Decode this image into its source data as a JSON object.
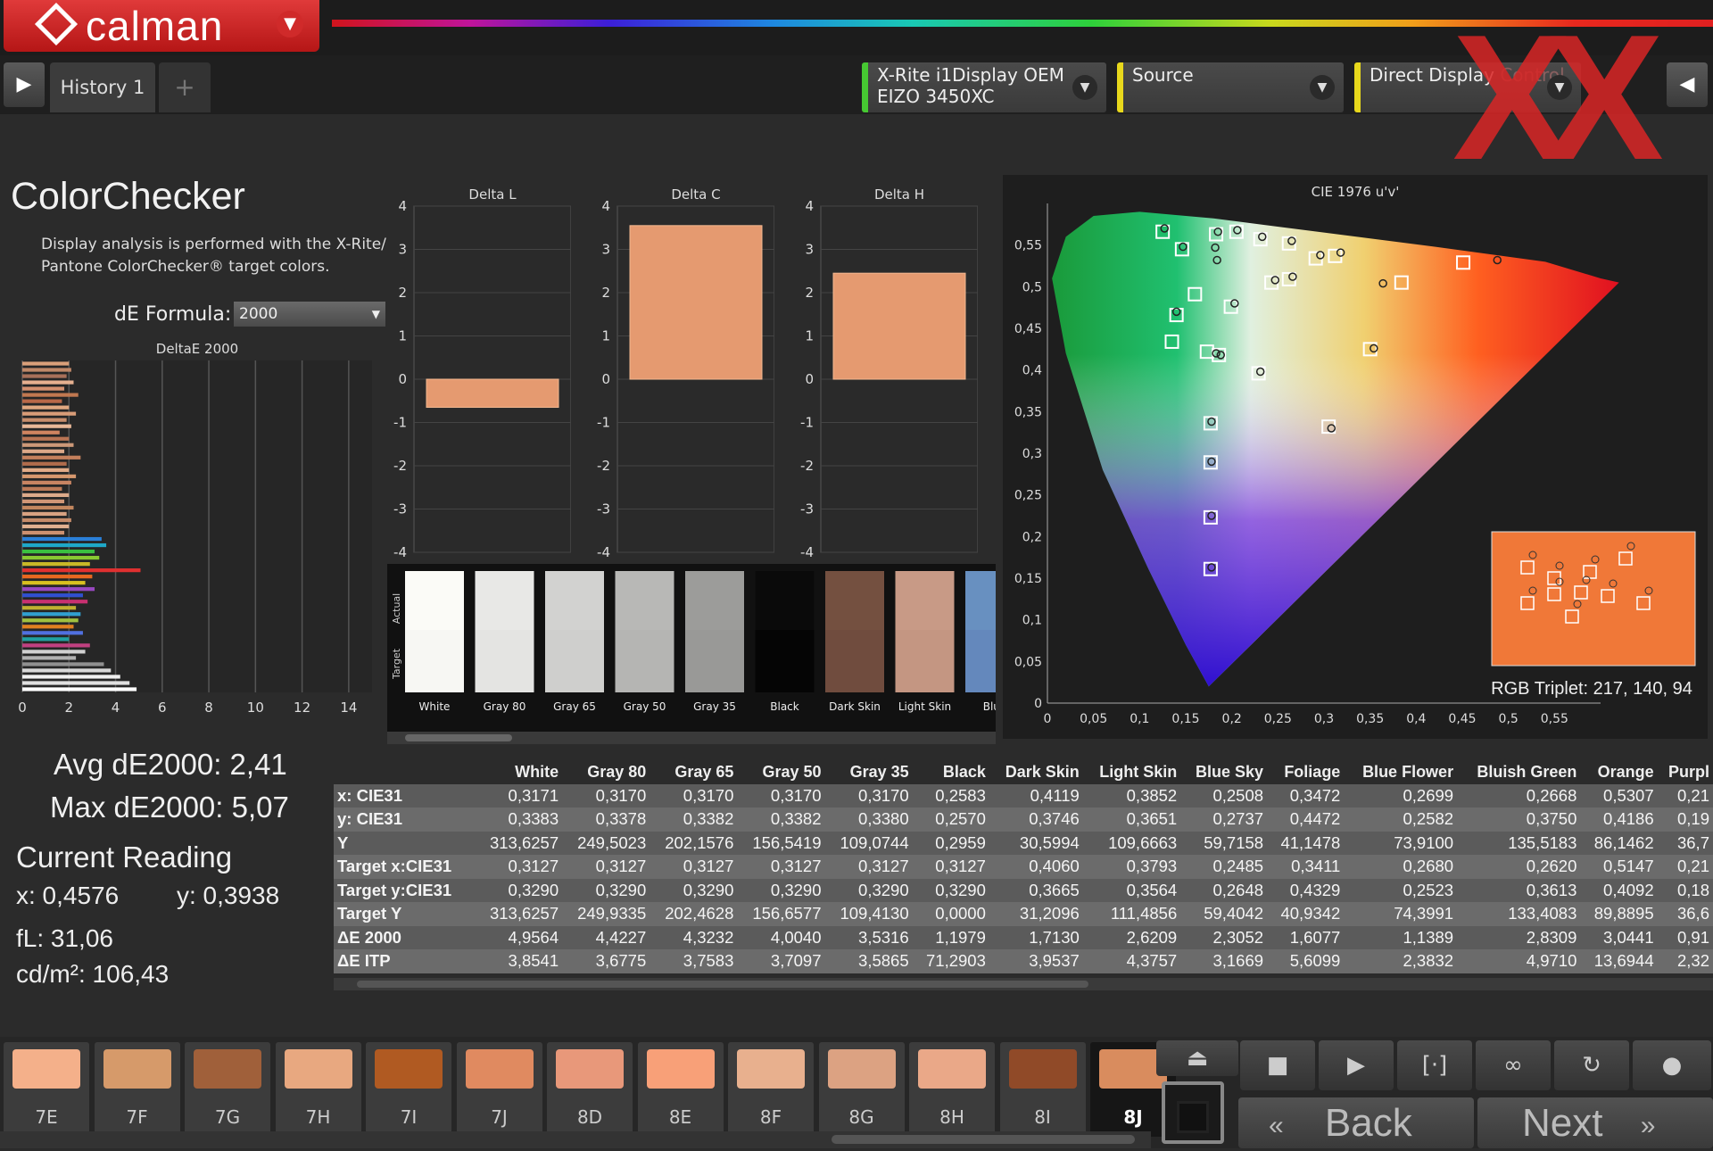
{
  "app": {
    "brand": "calman",
    "menu_icon": "chevron-down-icon"
  },
  "tabs": {
    "history_label": "History 1",
    "add_label": "+"
  },
  "devices": {
    "meter_line1": "X-Rite i1Display OEM",
    "meter_line2": "EIZO 3450XC",
    "source": "Source",
    "display": "Direct Display",
    "display_ghost": "Control"
  },
  "watermark": "XX",
  "page": {
    "title": "ColorChecker",
    "description": "Display analysis is performed with the X-Rite/ Pantone ColorChecker® target colors.",
    "formula_label": "dE Formula:",
    "formula_value": "2000"
  },
  "stats": {
    "avg": "Avg dE2000: 2,41",
    "max": "Max dE2000: 5,07",
    "current_title": "Current Reading",
    "x": "x: 0,4576",
    "y": "y: 0,3938",
    "fl": "fL: 31,06",
    "cdm2": "cd/m²: 106,43"
  },
  "chart_data": [
    {
      "type": "bar",
      "orientation": "horizontal",
      "title": "DeltaE 2000",
      "xlim": [
        0,
        15
      ],
      "xticks": [
        "0",
        "2",
        "4",
        "6",
        "8",
        "10",
        "12",
        "14"
      ],
      "values": [
        2.0,
        2.1,
        1.9,
        2.2,
        1.8,
        2.4,
        1.7,
        2.0,
        2.3,
        1.9,
        2.1,
        1.6,
        2.0,
        2.2,
        1.8,
        2.5,
        1.9,
        2.0,
        2.3,
        2.1,
        1.7,
        2.0,
        1.8,
        2.2,
        1.9,
        2.1,
        2.0,
        1.8,
        3.4,
        3.6,
        3.1,
        3.3,
        2.9,
        5.07,
        3.0,
        2.7,
        3.1,
        2.6,
        2.8,
        2.3,
        2.5,
        2.4,
        2.2,
        2.6,
        2.0,
        2.9,
        2.7,
        2.3,
        3.5,
        3.8,
        4.2,
        4.6,
        4.9
      ],
      "colors": [
        "#d9a07a",
        "#c08868",
        "#a8705a",
        "#e6b090",
        "#d49070",
        "#c07850",
        "#b86848",
        "#e0a880",
        "#d89c78",
        "#c88e6c",
        "#e8b898",
        "#d08460",
        "#b87454",
        "#cc9878",
        "#dca888",
        "#c4805c",
        "#b06c4c",
        "#e2ac88",
        "#d6986e",
        "#c88462",
        "#bc7a58",
        "#dcaa8a",
        "#d09676",
        "#c2865e",
        "#d8a282",
        "#c68c6a",
        "#e0b090",
        "#cc9070",
        "#2a7fd8",
        "#1ea8c8",
        "#3ac040",
        "#88c832",
        "#c8b828",
        "#e03030",
        "#e86820",
        "#d8c020",
        "#9848c0",
        "#3050d0",
        "#c83070",
        "#c0b030",
        "#30a0d0",
        "#a0c040",
        "#e08020",
        "#5070e0",
        "#20a0a0",
        "#c04080",
        "#d0d0d0",
        "#b0b0b0",
        "#909090",
        "#d8d8d8",
        "#f0f0f0",
        "#e0e0e0",
        "#ffffff"
      ]
    },
    {
      "type": "bar",
      "title": "Delta L",
      "ylim": [
        -4,
        4
      ],
      "yticks": [
        "4",
        "3",
        "2",
        "1",
        "0",
        "-1",
        "-2",
        "-3",
        "-4"
      ],
      "values": [
        -0.65
      ]
    },
    {
      "type": "bar",
      "title": "Delta C",
      "ylim": [
        -4,
        4
      ],
      "yticks": [
        "4",
        "3",
        "2",
        "1",
        "0",
        "-1",
        "-2",
        "-3",
        "-4"
      ],
      "values": [
        3.55
      ]
    },
    {
      "type": "bar",
      "title": "Delta H",
      "ylim": [
        -4,
        4
      ],
      "yticks": [
        "4",
        "3",
        "2",
        "1",
        "0",
        "-1",
        "-2",
        "-3",
        "-4"
      ],
      "values": [
        2.45
      ]
    },
    {
      "type": "scatter",
      "title": "CIE 1976 u'v'",
      "xlim": [
        0,
        0.6
      ],
      "ylim": [
        0,
        0.6
      ],
      "xticks": [
        "0",
        "0,05",
        "0,1",
        "0,15",
        "0,2",
        "0,25",
        "0,3",
        "0,35",
        "0,4",
        "0,45",
        "0,5",
        "0,55"
      ],
      "yticks": [
        "0,55",
        "0,5",
        "0,45",
        "0,4",
        "0,35",
        "0,3",
        "0,25",
        "0,2",
        "0,15",
        "0,1",
        "0,05",
        "0"
      ],
      "targets": [
        [
          0.125,
          0.566
        ],
        [
          0.146,
          0.545
        ],
        [
          0.183,
          0.563
        ],
        [
          0.205,
          0.566
        ],
        [
          0.231,
          0.557
        ],
        [
          0.262,
          0.552
        ],
        [
          0.243,
          0.505
        ],
        [
          0.262,
          0.509
        ],
        [
          0.291,
          0.534
        ],
        [
          0.312,
          0.537
        ],
        [
          0.384,
          0.505
        ],
        [
          0.451,
          0.529
        ],
        [
          0.16,
          0.491
        ],
        [
          0.14,
          0.466
        ],
        [
          0.199,
          0.476
        ],
        [
          0.135,
          0.434
        ],
        [
          0.186,
          0.418
        ],
        [
          0.173,
          0.422
        ],
        [
          0.229,
          0.396
        ],
        [
          0.35,
          0.425
        ],
        [
          0.177,
          0.336
        ],
        [
          0.177,
          0.289
        ],
        [
          0.305,
          0.332
        ],
        [
          0.177,
          0.223
        ],
        [
          0.177,
          0.161
        ]
      ],
      "measured": [
        [
          0.127,
          0.57
        ],
        [
          0.147,
          0.548
        ],
        [
          0.185,
          0.566
        ],
        [
          0.206,
          0.568
        ],
        [
          0.233,
          0.56
        ],
        [
          0.265,
          0.555
        ],
        [
          0.247,
          0.508
        ],
        [
          0.266,
          0.512
        ],
        [
          0.296,
          0.538
        ],
        [
          0.318,
          0.541
        ],
        [
          0.364,
          0.504
        ],
        [
          0.488,
          0.532
        ],
        [
          0.184,
          0.532
        ],
        [
          0.182,
          0.547
        ],
        [
          0.203,
          0.48
        ],
        [
          0.14,
          0.47
        ],
        [
          0.183,
          0.42
        ],
        [
          0.188,
          0.418
        ],
        [
          0.231,
          0.398
        ],
        [
          0.354,
          0.426
        ],
        [
          0.178,
          0.338
        ],
        [
          0.178,
          0.29
        ],
        [
          0.308,
          0.33
        ],
        [
          0.178,
          0.225
        ],
        [
          0.178,
          0.163
        ]
      ],
      "annotation": "RGB Triplet: 217, 140, 94"
    },
    {
      "type": "table",
      "columns": [
        "White",
        "Gray 80",
        "Gray 65",
        "Gray 50",
        "Gray 35",
        "Black",
        "Dark Skin",
        "Light Skin",
        "Blue Sky",
        "Foliage",
        "Blue Flower",
        "Bluish Green",
        "Orange",
        "Purpl"
      ],
      "rows": [
        {
          "label": "x: CIE31",
          "values": [
            "0,3171",
            "0,3170",
            "0,3170",
            "0,3170",
            "0,3170",
            "0,2583",
            "0,4119",
            "0,3852",
            "0,2508",
            "0,3472",
            "0,2699",
            "0,2668",
            "0,5307",
            "0,21"
          ]
        },
        {
          "label": "y: CIE31",
          "values": [
            "0,3383",
            "0,3378",
            "0,3382",
            "0,3382",
            "0,3380",
            "0,2570",
            "0,3746",
            "0,3651",
            "0,2737",
            "0,4472",
            "0,2582",
            "0,3750",
            "0,4186",
            "0,19"
          ]
        },
        {
          "label": "Y",
          "values": [
            "313,6257",
            "249,5023",
            "202,1576",
            "156,5419",
            "109,0744",
            "0,2959",
            "30,5994",
            "109,6663",
            "59,7158",
            "41,1478",
            "73,9100",
            "135,5183",
            "86,1462",
            "36,7"
          ]
        },
        {
          "label": "Target x:CIE31",
          "values": [
            "0,3127",
            "0,3127",
            "0,3127",
            "0,3127",
            "0,3127",
            "0,3127",
            "0,4060",
            "0,3793",
            "0,2485",
            "0,3411",
            "0,2680",
            "0,2620",
            "0,5147",
            "0,21"
          ]
        },
        {
          "label": "Target y:CIE31",
          "values": [
            "0,3290",
            "0,3290",
            "0,3290",
            "0,3290",
            "0,3290",
            "0,3290",
            "0,3665",
            "0,3564",
            "0,2648",
            "0,4329",
            "0,2523",
            "0,3613",
            "0,4092",
            "0,18"
          ]
        },
        {
          "label": "Target Y",
          "values": [
            "313,6257",
            "249,9335",
            "202,4628",
            "156,6577",
            "109,4130",
            "0,0000",
            "31,2096",
            "111,4856",
            "59,4042",
            "40,9342",
            "74,3991",
            "133,4083",
            "89,8895",
            "36,6"
          ]
        },
        {
          "label": "ΔE 2000",
          "values": [
            "4,9564",
            "4,4227",
            "4,3232",
            "4,0040",
            "3,5316",
            "1,1979",
            "1,7130",
            "2,6209",
            "2,3052",
            "1,6077",
            "1,1389",
            "2,8309",
            "3,0441",
            "0,91"
          ]
        },
        {
          "label": "ΔE ITP",
          "values": [
            "3,8541",
            "3,6775",
            "3,7583",
            "3,7097",
            "3,5865",
            "71,2903",
            "3,9537",
            "4,3757",
            "3,1669",
            "5,6099",
            "2,3832",
            "4,9710",
            "13,6944",
            "2,32"
          ]
        }
      ]
    }
  ],
  "patch_strip": {
    "actual_label": "Actual",
    "target_label": "Target",
    "patches": [
      {
        "label": "White",
        "actual": "#fbfbf7",
        "target": "#f7f7f3"
      },
      {
        "label": "Gray 80",
        "actual": "#e8e8e6",
        "target": "#e4e4e2"
      },
      {
        "label": "Gray 65",
        "actual": "#d2d2d0",
        "target": "#cfcfcd"
      },
      {
        "label": "Gray 50",
        "actual": "#b8b8b6",
        "target": "#b5b5b3"
      },
      {
        "label": "Gray 35",
        "actual": "#9c9c9a",
        "target": "#999997"
      },
      {
        "label": "Black",
        "actual": "#0a0a0a",
        "target": "#050505"
      },
      {
        "label": "Dark Skin",
        "actual": "#745040",
        "target": "#704c3e"
      },
      {
        "label": "Light Skin",
        "actual": "#c89a86",
        "target": "#c49682"
      },
      {
        "label": "Blue",
        "actual": "#6890c0",
        "target": "#6488bc"
      }
    ]
  },
  "swatches": [
    {
      "label": "7E",
      "color": "#f4b08a"
    },
    {
      "label": "7F",
      "color": "#d69a6a"
    },
    {
      "label": "7G",
      "color": "#a0603a"
    },
    {
      "label": "7H",
      "color": "#e8a880"
    },
    {
      "label": "7I",
      "color": "#b05a22"
    },
    {
      "label": "7J",
      "color": "#e08a60"
    },
    {
      "label": "8D",
      "color": "#e8987a"
    },
    {
      "label": "8E",
      "color": "#f8a078"
    },
    {
      "label": "8F",
      "color": "#e8b08e"
    },
    {
      "label": "8G",
      "color": "#dca282"
    },
    {
      "label": "8H",
      "color": "#eaa888"
    },
    {
      "label": "8I",
      "color": "#904a28"
    },
    {
      "label": "8J",
      "color": "#d98c5e"
    }
  ],
  "controls": {
    "back": "Back",
    "next": "Next"
  },
  "colors": {
    "accent_red": "#d92626",
    "bar_orange": "#e59a70",
    "meter_green": "#46c832",
    "source_yellow": "#e8d81c"
  }
}
